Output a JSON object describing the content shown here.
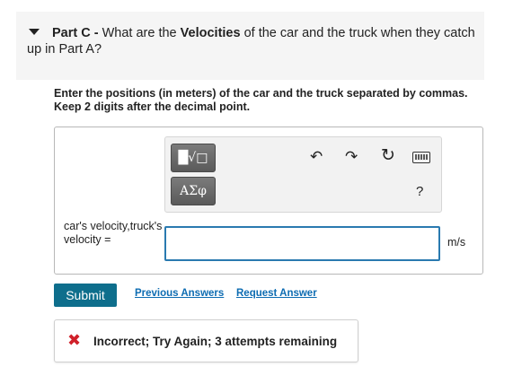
{
  "part": {
    "label": "Part C -",
    "question_pre": "What are the",
    "question_bold": "Velocities",
    "question_post": "of the car and the truck when they catch",
    "question_line2": "up in Part A?"
  },
  "instructions": "Enter the positions (in meters) of the car and the truck separated by commas. Keep 2 digits after the decimal point.",
  "toolbar": {
    "templates_glyph": "█√□",
    "symbols_glyph": "ΑΣφ",
    "undo_glyph": "↶",
    "redo_glyph": "↷",
    "reset_glyph": "↻",
    "help_glyph": "?"
  },
  "answer": {
    "label": "car's velocity,truck's velocity =",
    "value": "",
    "unit": "m/s"
  },
  "actions": {
    "submit": "Submit",
    "previous_answers": "Previous Answers",
    "request_answer": "Request Answer"
  },
  "feedback": {
    "icon": "✖",
    "message": "Incorrect; Try Again; 3 attempts remaining"
  },
  "colors": {
    "submit_bg": "#0e6e8c",
    "link": "#0d6cb2",
    "error": "#d0202a",
    "input_border": "#2a7ab0"
  }
}
